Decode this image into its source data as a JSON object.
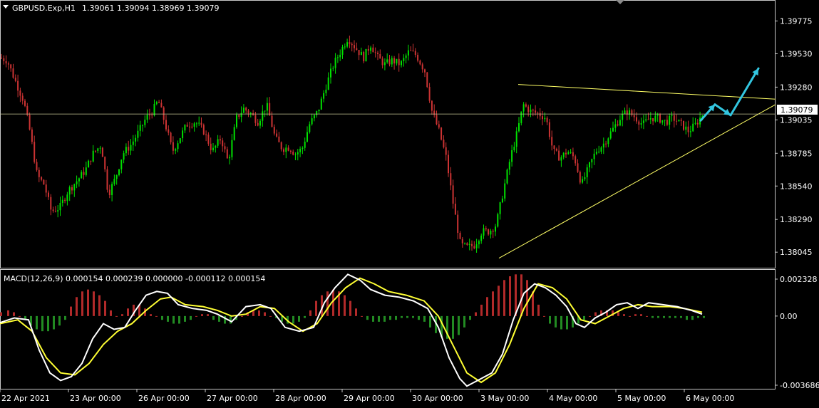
{
  "window": {
    "symbol_label": "GBPUSD.Exp,H1",
    "ohlc_label": "1.39061 1.39094 1.38969 1.39079",
    "current_price_label": "1.39079"
  },
  "macd_panel": {
    "label": "MACD(12,26,9) 0.000154 0.000239 0.000000 -0.000112 0.000154",
    "axis_labels": [
      "0.002328",
      "0.00",
      "-0.003686"
    ]
  },
  "colors": {
    "background": "#000000",
    "bull_candle": "#00e000",
    "bear_candle": "#cc3333",
    "axis": "#c8c8c8",
    "trendline": "#ffff66",
    "arrow": "#33c6e0",
    "macd_line": "#ffffff",
    "signal_line": "#ffff33",
    "hist_pos": "#b22a2a",
    "hist_neg": "#228b22"
  },
  "chart_data": [
    {
      "type": "candlestick",
      "series": [
        {
          "name": "GBPUSD.Exp,H1"
        }
      ],
      "y_ticks": [
        "1.39775",
        "1.39530",
        "1.39280",
        "1.39035",
        "1.38785",
        "1.38540",
        "1.38290",
        "1.38045"
      ],
      "ylim": [
        1.3795,
        1.399
      ],
      "x_ticks": [
        "22 Apr 2021",
        "23 Apr 00:00",
        "26 Apr 00:00",
        "27 Apr 00:00",
        "28 Apr 00:00",
        "29 Apr 00:00",
        "30 Apr 00:00",
        "3 May 00:00",
        "4 May 00:00",
        "5 May 00:00",
        "6 May 00:00"
      ],
      "current_price": 1.39079,
      "close_path": [
        [
          0,
          1.395
        ],
        [
          10,
          1.3948
        ],
        [
          22,
          1.3932
        ],
        [
          33,
          1.3918
        ],
        [
          42,
          1.3895
        ],
        [
          52,
          1.3862
        ],
        [
          62,
          1.3855
        ],
        [
          72,
          1.3835
        ],
        [
          84,
          1.3838
        ],
        [
          95,
          1.385
        ],
        [
          108,
          1.3858
        ],
        [
          120,
          1.3866
        ],
        [
          130,
          1.3878
        ],
        [
          142,
          1.3885
        ],
        [
          152,
          1.3848
        ],
        [
          162,
          1.386
        ],
        [
          172,
          1.3878
        ],
        [
          184,
          1.3885
        ],
        [
          195,
          1.3895
        ],
        [
          205,
          1.3905
        ],
        [
          214,
          1.391
        ],
        [
          222,
          1.3918
        ],
        [
          232,
          1.39
        ],
        [
          242,
          1.388
        ],
        [
          252,
          1.389
        ],
        [
          262,
          1.39
        ],
        [
          274,
          1.3902
        ],
        [
          286,
          1.3895
        ],
        [
          298,
          1.388
        ],
        [
          310,
          1.389
        ],
        [
          320,
          1.3872
        ],
        [
          332,
          1.3905
        ],
        [
          342,
          1.3912
        ],
        [
          352,
          1.3908
        ],
        [
          362,
          1.3902
        ],
        [
          374,
          1.3915
        ],
        [
          386,
          1.389
        ],
        [
          396,
          1.3882
        ],
        [
          406,
          1.3883
        ],
        [
          414,
          1.3878
        ],
        [
          424,
          1.3882
        ],
        [
          434,
          1.39
        ],
        [
          446,
          1.391
        ],
        [
          458,
          1.393
        ],
        [
          468,
          1.3945
        ],
        [
          478,
          1.3955
        ],
        [
          488,
          1.3965
        ],
        [
          498,
          1.3958
        ],
        [
          510,
          1.395
        ],
        [
          520,
          1.396
        ],
        [
          530,
          1.395
        ],
        [
          540,
          1.3945
        ],
        [
          550,
          1.3948
        ],
        [
          562,
          1.3945
        ],
        [
          574,
          1.3955
        ],
        [
          584,
          1.3952
        ],
        [
          596,
          1.394
        ],
        [
          606,
          1.391
        ],
        [
          616,
          1.3895
        ],
        [
          626,
          1.3875
        ],
        [
          636,
          1.384
        ],
        [
          646,
          1.381
        ],
        [
          656,
          1.3808
        ],
        [
          666,
          1.381
        ],
        [
          676,
          1.382
        ],
        [
          686,
          1.382
        ],
        [
          696,
          1.3825
        ],
        [
          706,
          1.385
        ],
        [
          716,
          1.3875
        ],
        [
          726,
          1.3895
        ],
        [
          734,
          1.3915
        ],
        [
          744,
          1.391
        ],
        [
          756,
          1.3908
        ],
        [
          766,
          1.3905
        ],
        [
          776,
          1.388
        ],
        [
          786,
          1.3875
        ],
        [
          796,
          1.388
        ],
        [
          806,
          1.3875
        ],
        [
          816,
          1.3855
        ],
        [
          826,
          1.3868
        ],
        [
          836,
          1.388
        ],
        [
          846,
          1.3885
        ],
        [
          858,
          1.3895
        ],
        [
          870,
          1.3905
        ],
        [
          880,
          1.391
        ],
        [
          892,
          1.3905
        ],
        [
          902,
          1.39
        ],
        [
          912,
          1.3905
        ],
        [
          922,
          1.3905
        ],
        [
          934,
          1.3902
        ],
        [
          944,
          1.3905
        ],
        [
          956,
          1.39
        ],
        [
          966,
          1.3895
        ],
        [
          976,
          1.39
        ],
        [
          986,
          1.3908
        ]
      ],
      "annotations": {
        "resistance_line": {
          "from": [
            727,
            1.393
          ],
          "to": [
            1088,
            1.3919
          ]
        },
        "support_line": {
          "from": [
            700,
            1.38
          ],
          "to": [
            1088,
            1.3915
          ]
        },
        "projection_arrow": [
          [
            983,
            1.3903
          ],
          [
            1003,
            1.3915
          ],
          [
            1025,
            1.3907
          ],
          [
            1064,
            1.3942
          ]
        ]
      }
    },
    {
      "type": "line",
      "series": [
        {
          "name": "MACD"
        },
        {
          "name": "Signal"
        }
      ],
      "y_ticks": [
        "0.002328",
        "0.00",
        "-0.003686"
      ],
      "ylim": [
        -0.0038,
        0.0024
      ],
      "macd": [
        [
          0,
          -0.00035
        ],
        [
          20,
          -0.0001
        ],
        [
          40,
          -0.0002
        ],
        [
          55,
          -0.0018
        ],
        [
          70,
          -0.003
        ],
        [
          85,
          -0.0034
        ],
        [
          100,
          -0.0032
        ],
        [
          115,
          -0.0025
        ],
        [
          130,
          -0.0012
        ],
        [
          145,
          -0.0004
        ],
        [
          160,
          -0.0007
        ],
        [
          175,
          -0.0006
        ],
        [
          190,
          0.0003
        ],
        [
          205,
          0.0011
        ],
        [
          220,
          0.0013
        ],
        [
          235,
          0.0012
        ],
        [
          250,
          0.0006
        ],
        [
          270,
          0.0004
        ],
        [
          290,
          0.0003
        ],
        [
          305,
          0.0001
        ],
        [
          325,
          -0.0003
        ],
        [
          345,
          0.0005
        ],
        [
          365,
          0.0006
        ],
        [
          380,
          0.0004
        ],
        [
          400,
          -0.0006
        ],
        [
          420,
          -0.0008
        ],
        [
          440,
          -0.0006
        ],
        [
          455,
          0.0007
        ],
        [
          470,
          0.0015
        ],
        [
          488,
          0.0022
        ],
        [
          505,
          0.0019
        ],
        [
          520,
          0.0014
        ],
        [
          540,
          0.0011
        ],
        [
          560,
          0.001
        ],
        [
          580,
          0.0008
        ],
        [
          600,
          0.0004
        ],
        [
          615,
          -0.0006
        ],
        [
          630,
          -0.0022
        ],
        [
          645,
          -0.0033
        ],
        [
          655,
          -0.0037
        ],
        [
          670,
          -0.0034
        ],
        [
          690,
          -0.003
        ],
        [
          705,
          -0.002
        ],
        [
          720,
          -0.0002
        ],
        [
          735,
          0.0012
        ],
        [
          750,
          0.0017
        ],
        [
          765,
          0.0015
        ],
        [
          780,
          0.0011
        ],
        [
          795,
          0.0005
        ],
        [
          808,
          -0.0004
        ],
        [
          820,
          -0.0006
        ],
        [
          835,
          -0.0001
        ],
        [
          850,
          0.0002
        ],
        [
          865,
          0.0006
        ],
        [
          880,
          0.0007
        ],
        [
          895,
          0.0004
        ],
        [
          910,
          0.0007
        ],
        [
          930,
          0.0006
        ],
        [
          950,
          0.0005
        ],
        [
          970,
          0.0003
        ],
        [
          985,
          0.0001
        ]
      ],
      "signal": [
        [
          0,
          -0.0004
        ],
        [
          25,
          -0.0002
        ],
        [
          45,
          -0.0008
        ],
        [
          65,
          -0.0022
        ],
        [
          85,
          -0.003
        ],
        [
          105,
          -0.0031
        ],
        [
          125,
          -0.0025
        ],
        [
          145,
          -0.0015
        ],
        [
          165,
          -0.0008
        ],
        [
          185,
          -0.0004
        ],
        [
          205,
          0.0003
        ],
        [
          225,
          0.0009
        ],
        [
          240,
          0.001
        ],
        [
          260,
          0.0006
        ],
        [
          285,
          0.0005
        ],
        [
          305,
          0.0003
        ],
        [
          325,
          0.0
        ],
        [
          345,
          0.0001
        ],
        [
          365,
          0.0005
        ],
        [
          385,
          0.0004
        ],
        [
          405,
          -0.0003
        ],
        [
          425,
          -0.0008
        ],
        [
          445,
          -0.0004
        ],
        [
          465,
          0.0007
        ],
        [
          485,
          0.0015
        ],
        [
          505,
          0.002
        ],
        [
          525,
          0.0017
        ],
        [
          545,
          0.0013
        ],
        [
          570,
          0.0011
        ],
        [
          595,
          0.0008
        ],
        [
          615,
          0.0
        ],
        [
          635,
          -0.0015
        ],
        [
          655,
          -0.003
        ],
        [
          675,
          -0.0035
        ],
        [
          695,
          -0.003
        ],
        [
          715,
          -0.0015
        ],
        [
          735,
          0.0004
        ],
        [
          755,
          0.0017
        ],
        [
          775,
          0.0015
        ],
        [
          795,
          0.0009
        ],
        [
          815,
          -0.0002
        ],
        [
          835,
          -0.0004
        ],
        [
          855,
          0.0
        ],
        [
          875,
          0.0004
        ],
        [
          895,
          0.0006
        ],
        [
          915,
          0.0005
        ],
        [
          940,
          0.0005
        ],
        [
          960,
          0.0004
        ],
        [
          985,
          0.0002
        ]
      ],
      "histogram": [
        [
          0,
          0.0002
        ],
        [
          10,
          0.0003
        ],
        [
          18,
          0.0002
        ],
        [
          26,
          0.0
        ],
        [
          34,
          -0.0002
        ],
        [
          42,
          -0.0005
        ],
        [
          50,
          -0.0007
        ],
        [
          58,
          -0.0008
        ],
        [
          66,
          -0.0008
        ],
        [
          74,
          -0.0007
        ],
        [
          82,
          -0.0005
        ],
        [
          90,
          -0.0002
        ],
        [
          98,
          0.0005
        ],
        [
          106,
          0.001
        ],
        [
          114,
          0.0013
        ],
        [
          122,
          0.0014
        ],
        [
          130,
          0.0013
        ],
        [
          138,
          0.0011
        ],
        [
          146,
          0.0008
        ],
        [
          154,
          0.0003
        ],
        [
          162,
          0.0
        ],
        [
          170,
          0.0001
        ],
        [
          178,
          0.0004
        ],
        [
          186,
          0.0006
        ],
        [
          194,
          0.0006
        ],
        [
          202,
          0.0004
        ],
        [
          210,
          0.0001
        ],
        [
          218,
          0.0
        ],
        [
          226,
          -0.0002
        ],
        [
          234,
          -0.0003
        ],
        [
          242,
          -0.0004
        ],
        [
          250,
          -0.0004
        ],
        [
          258,
          -0.0003
        ],
        [
          266,
          -0.0002
        ],
        [
          274,
          0.0
        ],
        [
          282,
          0.0001
        ],
        [
          290,
          0.0001
        ],
        [
          298,
          -0.0002
        ],
        [
          306,
          -0.0003
        ],
        [
          314,
          -0.0004
        ],
        [
          322,
          -0.0004
        ],
        [
          330,
          -0.0002
        ],
        [
          338,
          0.0
        ],
        [
          346,
          0.0002
        ],
        [
          354,
          0.0003
        ],
        [
          362,
          0.0003
        ],
        [
          370,
          0.0002
        ],
        [
          378,
          0.0
        ],
        [
          386,
          -0.0001
        ],
        [
          394,
          -0.0003
        ],
        [
          402,
          -0.0004
        ],
        [
          410,
          -0.0004
        ],
        [
          418,
          -0.0003
        ],
        [
          426,
          -0.0001
        ],
        [
          434,
          0.0003
        ],
        [
          442,
          0.0008
        ],
        [
          450,
          0.0011
        ],
        [
          458,
          0.0013
        ],
        [
          466,
          0.0014
        ],
        [
          474,
          0.0013
        ],
        [
          482,
          0.0011
        ],
        [
          490,
          0.0008
        ],
        [
          498,
          0.0004
        ],
        [
          506,
          0.0
        ],
        [
          514,
          -0.0002
        ],
        [
          522,
          -0.0003
        ],
        [
          530,
          -0.0003
        ],
        [
          538,
          -0.0003
        ],
        [
          546,
          -0.0002
        ],
        [
          554,
          -0.0002
        ],
        [
          562,
          -0.0001
        ],
        [
          570,
          -0.0001
        ],
        [
          578,
          -0.0001
        ],
        [
          586,
          -0.0002
        ],
        [
          594,
          -0.0003
        ],
        [
          602,
          -0.0006
        ],
        [
          610,
          -0.0009
        ],
        [
          618,
          -0.0011
        ],
        [
          626,
          -0.0012
        ],
        [
          634,
          -0.0012
        ],
        [
          642,
          -0.001
        ],
        [
          650,
          -0.0006
        ],
        [
          658,
          -0.0002
        ],
        [
          666,
          0.0002
        ],
        [
          674,
          0.0006
        ],
        [
          682,
          0.001
        ],
        [
          690,
          0.0013
        ],
        [
          698,
          0.0016
        ],
        [
          706,
          0.0019
        ],
        [
          714,
          0.0021
        ],
        [
          722,
          0.0022
        ],
        [
          730,
          0.0022
        ],
        [
          738,
          0.0019
        ],
        [
          746,
          0.0013
        ],
        [
          754,
          0.0006
        ],
        [
          762,
          0.0
        ],
        [
          770,
          -0.0004
        ],
        [
          778,
          -0.0006
        ],
        [
          786,
          -0.0007
        ],
        [
          794,
          -0.0007
        ],
        [
          802,
          -0.0006
        ],
        [
          810,
          -0.0004
        ],
        [
          818,
          -0.0002
        ],
        [
          826,
          0.0
        ],
        [
          834,
          0.0002
        ],
        [
          842,
          0.0003
        ],
        [
          850,
          0.0003
        ],
        [
          858,
          0.0003
        ],
        [
          866,
          0.0002
        ],
        [
          874,
          0.0001
        ],
        [
          882,
          0.0
        ],
        [
          890,
          0.0001
        ],
        [
          898,
          0.0001
        ],
        [
          906,
          0.0
        ],
        [
          914,
          -0.0001
        ],
        [
          922,
          -0.0001
        ],
        [
          930,
          -0.0001
        ],
        [
          938,
          -0.0001
        ],
        [
          946,
          -0.0001
        ],
        [
          954,
          -0.0001
        ],
        [
          962,
          -0.0002
        ],
        [
          970,
          -0.0002
        ],
        [
          978,
          -0.0001
        ],
        [
          986,
          -0.0001
        ]
      ]
    }
  ]
}
